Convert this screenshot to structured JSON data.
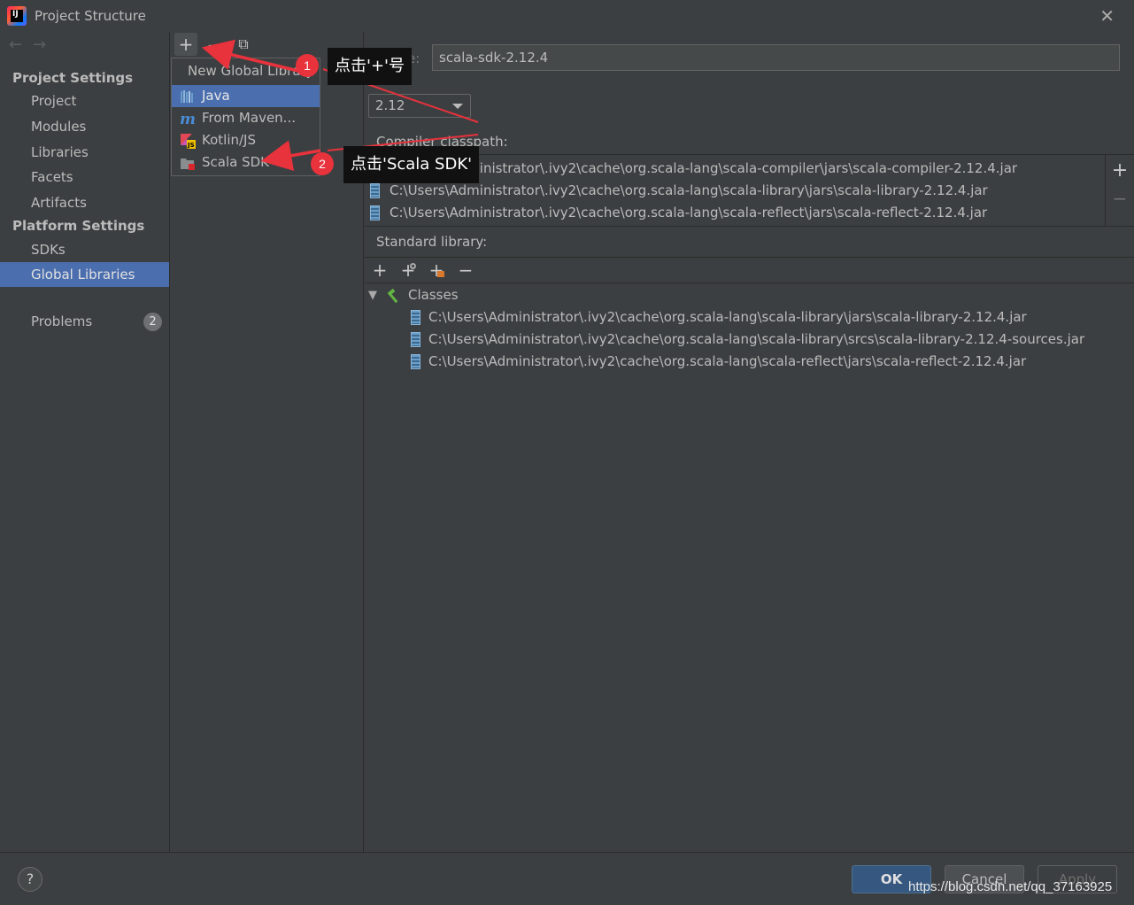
{
  "window": {
    "title": "Project Structure",
    "app_icon_text": "IJ",
    "close_glyph": "✕"
  },
  "sidebar": {
    "back_glyph": "←",
    "forward_glyph": "→",
    "project_settings_header": "Project Settings",
    "project_items": [
      "Project",
      "Modules",
      "Libraries",
      "Facets",
      "Artifacts"
    ],
    "platform_settings_header": "Platform Settings",
    "platform_items": [
      "SDKs",
      "Global Libraries"
    ],
    "selected_item": "Global Libraries",
    "problems_label": "Problems",
    "problems_count": "2"
  },
  "toolbar": {
    "add_glyph": "+",
    "remove_glyph": "−",
    "copy_glyph": "⧉"
  },
  "popup": {
    "header": "New Global Library",
    "items": [
      {
        "label": "Java",
        "icon": "java-library-icon"
      },
      {
        "label": "From Maven...",
        "icon": "maven-icon"
      },
      {
        "label": "Kotlin/JS",
        "icon": "kotlin-js-icon"
      },
      {
        "label": "Scala SDK",
        "icon": "scala-sdk-icon"
      }
    ],
    "selected": "Java"
  },
  "details": {
    "name_label": "Name:",
    "name_value": "scala-sdk-2.12.4",
    "version_value": "2.12",
    "compiler_classpath_label": "Compiler classpath:",
    "compiler_classpath": [
      "C:\\Users\\Administrator\\.ivy2\\cache\\org.scala-lang\\scala-compiler\\jars\\scala-compiler-2.12.4.jar",
      "C:\\Users\\Administrator\\.ivy2\\cache\\org.scala-lang\\scala-library\\jars\\scala-library-2.12.4.jar",
      "C:\\Users\\Administrator\\.ivy2\\cache\\org.scala-lang\\scala-reflect\\jars\\scala-reflect-2.12.4.jar"
    ],
    "classpath_add_glyph": "+",
    "classpath_remove_glyph": "−",
    "standard_library_label": "Standard library:",
    "classes_label": "Classes",
    "classes": [
      "C:\\Users\\Administrator\\.ivy2\\cache\\org.scala-lang\\scala-library\\jars\\scala-library-2.12.4.jar",
      "C:\\Users\\Administrator\\.ivy2\\cache\\org.scala-lang\\scala-library\\srcs\\scala-library-2.12.4-sources.jar",
      "C:\\Users\\Administrator\\.ivy2\\cache\\org.scala-lang\\scala-reflect\\jars\\scala-reflect-2.12.4.jar"
    ]
  },
  "footer": {
    "help_label": "?",
    "ok_label": "OK",
    "cancel_label": "Cancel",
    "apply_label": "Apply"
  },
  "annotations": {
    "step1_number": "1",
    "step1_text": "点击'+'号",
    "step2_number": "2",
    "step2_text": "点击'Scala SDK'"
  },
  "watermark": "https://blog.csdn.net/qq_37163925",
  "colors": {
    "selection": "#4b6eaf",
    "background": "#3c3f41",
    "annotation_red": "#e8323c",
    "ok_button": "#365880"
  }
}
